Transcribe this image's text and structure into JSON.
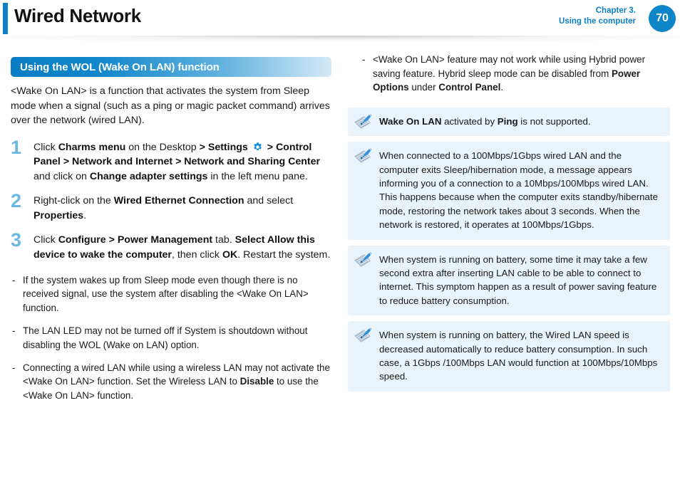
{
  "header": {
    "title": "Wired Network",
    "chapter_line1": "Chapter 3.",
    "chapter_line2": "Using the computer",
    "page_number": "70",
    "accent_color": "#0d80c6",
    "page_number_color": "#0d85c9"
  },
  "section": {
    "heading": "Using the WOL (Wake On LAN) function",
    "intro": "<Wake On LAN> is a function that activates the system from Sleep mode when a signal (such as a ping or magic packet command) arrives over the network (wired LAN)."
  },
  "steps": [
    {
      "number": "1",
      "parts": [
        {
          "text": "Click ",
          "bold": false
        },
        {
          "text": "Charms menu",
          "bold": true
        },
        {
          "text": " on the Desktop ",
          "bold": false
        },
        {
          "text": "> Settings ",
          "bold": true
        },
        {
          "icon": "gear-icon"
        },
        {
          "text": " > ",
          "bold": true
        },
        {
          "text": "Control Panel > Network and Internet > Network and Sharing Center",
          "bold": true
        },
        {
          "text": " and click on ",
          "bold": false
        },
        {
          "text": "Change adapter settings",
          "bold": true
        },
        {
          "text": " in the left menu pane.",
          "bold": false
        }
      ]
    },
    {
      "number": "2",
      "parts": [
        {
          "text": "Right-click on the ",
          "bold": false
        },
        {
          "text": "Wired Ethernet Connection",
          "bold": true
        },
        {
          "text": " and select ",
          "bold": false
        },
        {
          "text": "Properties",
          "bold": true
        },
        {
          "text": ".",
          "bold": false
        }
      ]
    },
    {
      "number": "3",
      "parts": [
        {
          "text": "Click ",
          "bold": false
        },
        {
          "text": "Configure > Power Management",
          "bold": true
        },
        {
          "text": " tab. ",
          "bold": false
        },
        {
          "text": "Select Allow this device to wake the computer",
          "bold": true
        },
        {
          "text": ", then click ",
          "bold": false
        },
        {
          "text": "OK",
          "bold": true
        },
        {
          "text": ". Restart the system.",
          "bold": false
        }
      ]
    }
  ],
  "left_bullets": [
    {
      "mark": "-",
      "parts": [
        {
          "text": "If the system wakes up from Sleep mode even though there is no received signal, use the system after disabling the <Wake On LAN> function.",
          "bold": false
        }
      ]
    },
    {
      "mark": "-",
      "parts": [
        {
          "text": "The LAN LED may not be turned off if System is shoutdown without disabling the WOL (Wake on LAN) option.",
          "bold": false
        }
      ]
    },
    {
      "mark": "-",
      "parts": [
        {
          "text": "Connecting a wired LAN while using a wireless LAN may not activate the <Wake On LAN> function. Set the Wireless LAN to ",
          "bold": false
        },
        {
          "text": "Disable",
          "bold": true
        },
        {
          "text": " to use the <Wake On LAN> function.",
          "bold": false
        }
      ]
    }
  ],
  "right_bullets": [
    {
      "mark": "-",
      "parts": [
        {
          "text": "<Wake On LAN> feature may not work while using Hybrid power saving feature. Hybrid sleep mode can be disabled from ",
          "bold": false
        },
        {
          "text": "Power Options",
          "bold": true
        },
        {
          "text": " under ",
          "bold": false
        },
        {
          "text": "Control Panel",
          "bold": true
        },
        {
          "text": ".",
          "bold": false
        }
      ]
    }
  ],
  "notes": [
    {
      "icon": "note-pencil-icon",
      "parts": [
        {
          "text": "Wake On LAN",
          "bold": true
        },
        {
          "text": " activated by ",
          "bold": false
        },
        {
          "text": "Ping",
          "bold": true
        },
        {
          "text": " is not supported.",
          "bold": false
        }
      ]
    },
    {
      "icon": "note-pencil-icon",
      "parts": [
        {
          "text": "When connected to a 100Mbps/1Gbps wired LAN and the computer exits Sleep/hibernation mode, a message appears informing you of a connection to a 10Mbps/100Mbps wired LAN. This happens because when the computer exits standby/hibernate mode, restoring the network takes about 3 seconds. When the network is restored, it operates at 100Mbps/1Gbps.",
          "bold": false
        }
      ]
    },
    {
      "icon": "note-pencil-icon",
      "parts": [
        {
          "text": "When system is running on battery, some time it may take a few second extra after inserting LAN cable to be able to connect to internet. This symptom happen as a result of power saving feature to reduce battery consumption.",
          "bold": false
        }
      ]
    },
    {
      "icon": "note-pencil-icon",
      "parts": [
        {
          "text": "When system is running on battery, the Wired LAN speed is decreased automatically to reduce battery consumption. In such case, a 1Gbps /100Mbps LAN would function at 100Mbps/10Mbps speed.",
          "bold": false
        }
      ]
    }
  ],
  "colors": {
    "accent_blue": "#0d80c6",
    "step_number_blue": "#6bb7e3",
    "note_background": "#e9f3fb",
    "section_bar_start": "#0a7dc4",
    "section_bar_end": "#d4e9f7"
  }
}
